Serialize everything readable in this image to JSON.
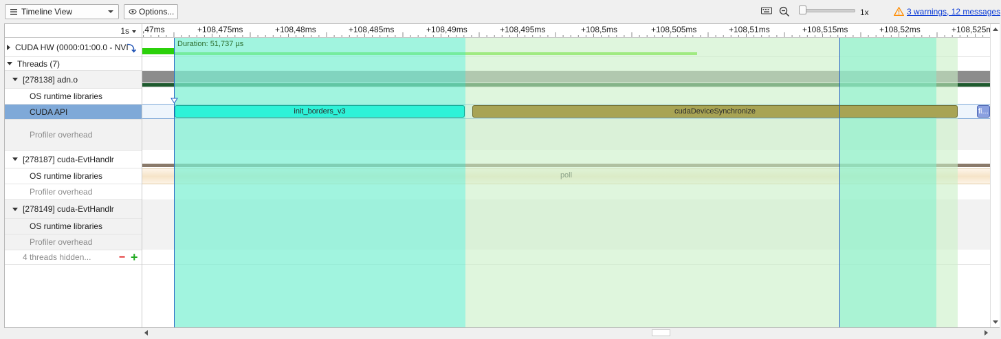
{
  "toolbar": {
    "view_label": "Timeline View",
    "options_label": "Options...",
    "zoom": 0,
    "zoom_label": "1x",
    "warnings_link": "3 warnings, 12 messages"
  },
  "timeline": {
    "scale_label": "1s",
    "ticks": [
      ",47ms",
      "+108,475ms",
      "+108,48ms",
      "+108,485ms",
      "+108,49ms",
      "+108,495ms",
      "+108,5ms",
      "+108,505ms",
      "+108,51ms",
      "+108,515ms",
      "+108,52ms",
      "+108,525m"
    ],
    "duration_label": "Duration: 51,737 µs"
  },
  "rows": [
    {
      "label": "CUDA HW (0000:01:00.0 - NVI"
    },
    {
      "label": "Threads (7)"
    },
    {
      "label": "[278138] adn.o"
    },
    {
      "label": "OS runtime libraries"
    },
    {
      "label": "CUDA API"
    },
    {
      "label": "Profiler overhead"
    },
    {
      "label": "[278187] cuda-EvtHandlr"
    },
    {
      "label": "OS runtime libraries"
    },
    {
      "label": "Profiler overhead"
    },
    {
      "label": "[278149] cuda-EvtHandlr"
    },
    {
      "label": "OS runtime libraries"
    },
    {
      "label": "Profiler overhead"
    },
    {
      "label": "4 threads hidden..."
    }
  ],
  "events": {
    "init_borders": "init_borders_v3",
    "cuda_sync": "cudaDeviceSynchronize",
    "truncated": "fi...",
    "poll": "poll"
  },
  "colors": {
    "selection": "#98f5dc",
    "range": "#d9f5dc",
    "cuda_kernel": "#2ef2d8",
    "cuda_sync": "#a8a454",
    "hw_bar": "#62e21a",
    "selected_row": "#7fa9d8",
    "warning": "#ff8c00"
  }
}
